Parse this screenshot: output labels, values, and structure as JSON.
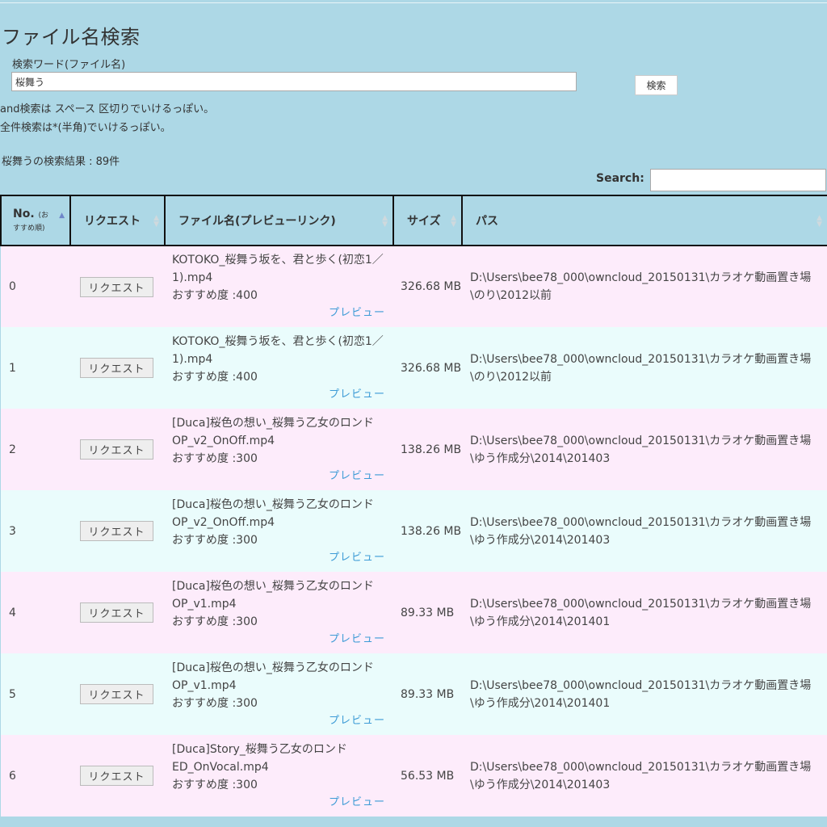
{
  "page": {
    "title": "ファイル名検索",
    "search_label": "検索ワード(ファイル名)",
    "search_value": "桜舞う",
    "search_button": "検索",
    "help_and": "and検索は スペース 区切りでいけるっぽい。",
    "help_all": "全件検索は*(半角)でいけるっぽい。",
    "result_count": "桜舞うの検索結果 : 89件"
  },
  "table": {
    "search_label": "Search:",
    "search_value": "",
    "headers": {
      "no": "No.",
      "no_sub1": "(お",
      "no_sub2": "すすめ順)",
      "request": "リクエスト",
      "filename": "ファイル名(プレビューリンク)",
      "size": "サイズ",
      "path": "パス"
    },
    "sorted_column": "no",
    "sort_direction": "ascending",
    "request_label": "リクエスト",
    "preview_label": "プレビュー",
    "rows": [
      {
        "no": "0",
        "filename": "KOTOKO_桜舞う坂を、君と歩く(初恋1／1).mp4",
        "rec": "おすすめ度 :400",
        "size": "326.68 MB",
        "path": "D:\\Users\\bee78_000\\owncloud_20150131\\カラオケ動画置き場\\のり\\2012以前"
      },
      {
        "no": "1",
        "filename": "KOTOKO_桜舞う坂を、君と歩く(初恋1／1).mp4",
        "rec": "おすすめ度 :400",
        "size": "326.68 MB",
        "path": "D:\\Users\\bee78_000\\owncloud_20150131\\カラオケ動画置き場\\のり\\2012以前"
      },
      {
        "no": "2",
        "filename": "[Duca]桜色の想い_桜舞う乙女のロンドOP_v2_OnOff.mp4",
        "rec": "おすすめ度 :300",
        "size": "138.26 MB",
        "path": "D:\\Users\\bee78_000\\owncloud_20150131\\カラオケ動画置き場\\ゆう作成分\\2014\\201403"
      },
      {
        "no": "3",
        "filename": "[Duca]桜色の想い_桜舞う乙女のロンドOP_v2_OnOff.mp4",
        "rec": "おすすめ度 :300",
        "size": "138.26 MB",
        "path": "D:\\Users\\bee78_000\\owncloud_20150131\\カラオケ動画置き場\\ゆう作成分\\2014\\201403"
      },
      {
        "no": "4",
        "filename": "[Duca]桜色の想い_桜舞う乙女のロンドOP_v1.mp4",
        "rec": "おすすめ度 :300",
        "size": "89.33 MB",
        "path": "D:\\Users\\bee78_000\\owncloud_20150131\\カラオケ動画置き場\\ゆう作成分\\2014\\201401"
      },
      {
        "no": "5",
        "filename": "[Duca]桜色の想い_桜舞う乙女のロンドOP_v1.mp4",
        "rec": "おすすめ度 :300",
        "size": "89.33 MB",
        "path": "D:\\Users\\bee78_000\\owncloud_20150131\\カラオケ動画置き場\\ゆう作成分\\2014\\201401"
      },
      {
        "no": "6",
        "filename": "[Duca]Story_桜舞う乙女のロンドED_OnVocal.mp4",
        "rec": "おすすめ度 :300",
        "size": "56.53 MB",
        "path": "D:\\Users\\bee78_000\\owncloud_20150131\\カラオケ動画置き場\\ゆう作成分\\2014\\201403"
      }
    ]
  },
  "colors": {
    "background": "#add8e6",
    "row_odd": "#fdecfb",
    "row_even": "#eafcfc",
    "link": "#3d9bd6"
  }
}
